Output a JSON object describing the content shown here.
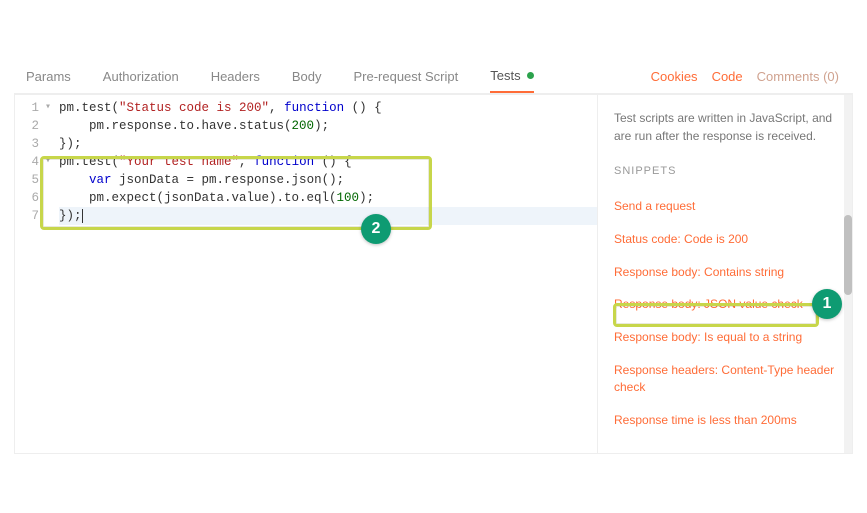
{
  "tabs": {
    "params": "Params",
    "authorization": "Authorization",
    "headers": "Headers",
    "body": "Body",
    "prerequest": "Pre-request Script",
    "tests": "Tests"
  },
  "right_links": {
    "cookies": "Cookies",
    "code": "Code",
    "comments": "Comments (0)"
  },
  "editor": {
    "line_numbers": [
      "1",
      "2",
      "3",
      "4",
      "5",
      "6",
      "7"
    ],
    "fold_markers": [
      "▾",
      "",
      "",
      "▾",
      "",
      "",
      ""
    ],
    "line1": {
      "a": "pm.test(",
      "s": "\"Status code is 200\"",
      "b": ", ",
      "kw": "function",
      "c": " () {"
    },
    "line2": {
      "a": "    pm.response.to.have.status(",
      "n": "200",
      "b": ");"
    },
    "line3": {
      "a": "});"
    },
    "line4": {
      "a": "pm.test(",
      "s": "\"Your test name\"",
      "b": ", ",
      "kw": "function",
      "c": " () {"
    },
    "line5": {
      "a": "    ",
      "kw": "var",
      "b": " jsonData = pm.response.json();"
    },
    "line6": {
      "a": "    pm.expect(jsonData.value).to.eql(",
      "n": "100",
      "b": ");"
    },
    "line7": {
      "a": "});"
    }
  },
  "side": {
    "desc": "Test scripts are written in JavaScript, and are run after the response is received.",
    "heading": "SNIPPETS",
    "items": [
      "Send a request",
      "Status code: Code is 200",
      "Response body: Contains string",
      "Response body: JSON value check",
      "Response body: Is equal to a string",
      "Response headers: Content-Type header check",
      "Response time is less than 200ms"
    ]
  },
  "annotations": {
    "badge1": "1",
    "badge2": "2"
  }
}
